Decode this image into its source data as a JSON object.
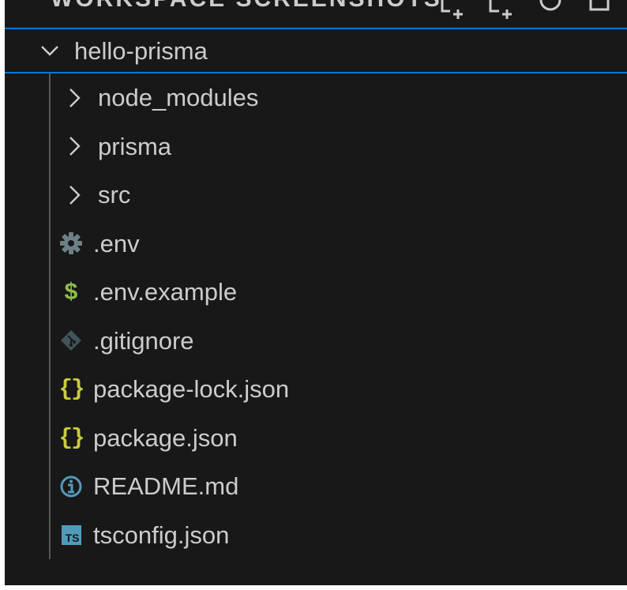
{
  "explorer": {
    "header_title_partial": "WORKSPACE SCREENSHOTS",
    "header_actions": [
      {
        "icon": "new-file-icon"
      },
      {
        "icon": "new-folder-icon"
      },
      {
        "icon": "refresh-icon"
      },
      {
        "icon": "collapse-all-icon"
      }
    ],
    "root": {
      "label": "hello-prisma",
      "expanded": true,
      "chevron_icon": "chevron-down-icon"
    },
    "items": [
      {
        "label": "node_modules",
        "type": "folder",
        "icon": "chevron-right-icon"
      },
      {
        "label": "prisma",
        "type": "folder",
        "icon": "chevron-right-icon"
      },
      {
        "label": "src",
        "type": "folder",
        "icon": "chevron-right-icon"
      },
      {
        "label": ".env",
        "type": "file",
        "icon": "gear-icon",
        "color": "#6d8086"
      },
      {
        "label": ".env.example",
        "type": "file",
        "icon": "dollar-icon",
        "glyph": "$",
        "color": "#8dc149"
      },
      {
        "label": ".gitignore",
        "type": "file",
        "icon": "git-icon",
        "color": "#41535b"
      },
      {
        "label": "package-lock.json",
        "type": "file",
        "icon": "json-braces-icon",
        "glyph": "{}",
        "color": "#cbcb41"
      },
      {
        "label": "package.json",
        "type": "file",
        "icon": "json-braces-icon",
        "glyph": "{}",
        "color": "#cbcb41"
      },
      {
        "label": "README.md",
        "type": "file",
        "icon": "info-icon",
        "color": "#519aba"
      },
      {
        "label": "tsconfig.json",
        "type": "file",
        "icon": "typescript-icon",
        "glyph": "TS",
        "color": "#519aba"
      }
    ]
  },
  "colors": {
    "background": "#181818",
    "text": "#cccccc",
    "focus_border": "#0078d4",
    "indent_guide": "#585858"
  }
}
